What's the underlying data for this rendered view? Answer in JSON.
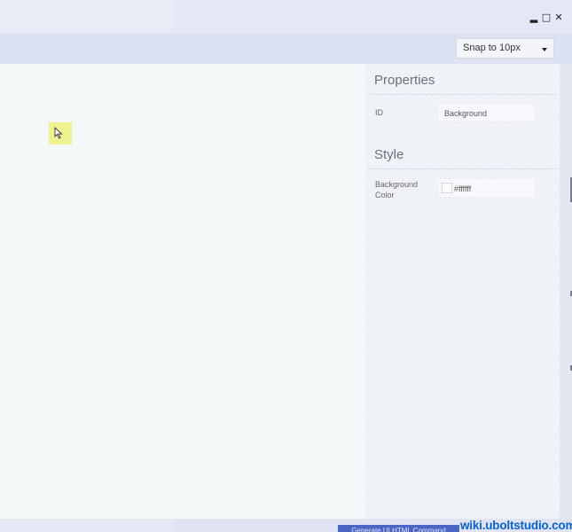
{
  "window_controls": {
    "minimize_icon": "minimize-icon",
    "maximize_icon": "maximize-icon",
    "close_icon": "close-icon"
  },
  "toolbar": {
    "snap_select": {
      "value": "Snap to 10px"
    }
  },
  "properties": {
    "title": "Properties",
    "id_label": "ID",
    "id_value": "Background"
  },
  "style": {
    "title": "Style",
    "bg_color_label_line1": "Background",
    "bg_color_label_line2": "Color",
    "bg_color_value": "#ffffff",
    "bg_color_swatch": "#ffffff"
  },
  "footer": {
    "generate_button": "Generate UI.HTML Command",
    "watermark": "wiki.uboltstudio.com"
  },
  "colors": {
    "accent": "#4a65c4",
    "watermark": "#0a63c7",
    "cursor_highlight": "#eef291"
  }
}
